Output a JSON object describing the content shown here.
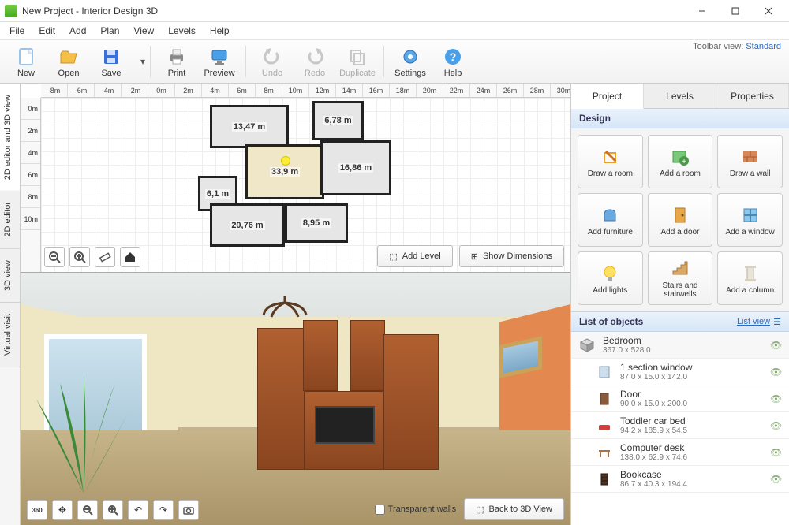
{
  "window": {
    "title": "New Project - Interior Design 3D"
  },
  "menu": [
    "File",
    "Edit",
    "Add",
    "Plan",
    "View",
    "Levels",
    "Help"
  ],
  "toolbar_view": {
    "label": "Toolbar view:",
    "mode": "Standard"
  },
  "toolbar": {
    "new": "New",
    "open": "Open",
    "save": "Save",
    "print": "Print",
    "preview": "Preview",
    "undo": "Undo",
    "redo": "Redo",
    "duplicate": "Duplicate",
    "settings": "Settings",
    "help": "Help"
  },
  "vtabs": {
    "combo": "2D editor and 3D view",
    "editor": "2D editor",
    "view3d": "3D view",
    "virtual": "Virtual visit"
  },
  "ruler_h": [
    "-8m",
    "-6m",
    "-4m",
    "-2m",
    "0m",
    "2m",
    "4m",
    "6m",
    "8m",
    "10m",
    "12m",
    "14m",
    "16m",
    "18m",
    "20m",
    "22m",
    "24m",
    "26m",
    "28m",
    "30m"
  ],
  "ruler_v": [
    "0m",
    "2m",
    "4m",
    "6m",
    "8m",
    "10m"
  ],
  "rooms": {
    "r1": "13,47 m",
    "r2": "6,78 m",
    "r3": "33,9 m",
    "r4": "16,86 m",
    "r5": "6,1 m",
    "r6": "20,76 m",
    "r7": "8,95 m"
  },
  "plan_buttons": {
    "add_level": "Add Level",
    "show_dim": "Show Dimensions"
  },
  "render_bottom": {
    "transparent": "Transparent walls",
    "back3d": "Back to 3D View"
  },
  "right_tabs": {
    "project": "Project",
    "levels": "Levels",
    "properties": "Properties"
  },
  "design_header": "Design",
  "design": {
    "draw_room": "Draw a room",
    "add_room": "Add a room",
    "draw_wall": "Draw a wall",
    "add_furniture": "Add furniture",
    "add_door": "Add a door",
    "add_window": "Add a window",
    "add_lights": "Add lights",
    "stairs": "Stairs and stairwells",
    "add_column": "Add a column"
  },
  "list_header": "List of objects",
  "list_view_label": "List view",
  "objects": [
    {
      "name": "Bedroom",
      "dim": "367.0 x 528.0",
      "parent": true
    },
    {
      "name": "1 section window",
      "dim": "87.0 x 15.0 x 142.0"
    },
    {
      "name": "Door",
      "dim": "90.0 x 15.0 x 200.0"
    },
    {
      "name": "Toddler car bed",
      "dim": "94.2 x 185.9 x 54.5"
    },
    {
      "name": "Computer desk",
      "dim": "138.0 x 62.9 x 74.6"
    },
    {
      "name": "Bookcase",
      "dim": "86.7 x 40.3 x 194.4"
    }
  ]
}
